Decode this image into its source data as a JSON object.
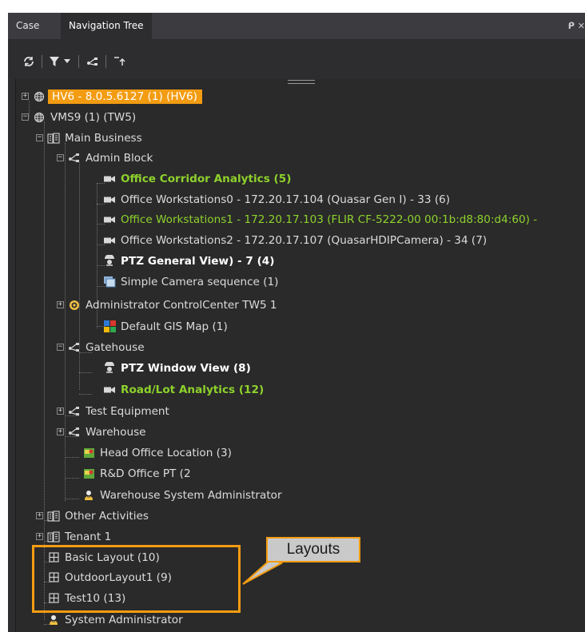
{
  "tabs": [
    {
      "label": "Case",
      "active": false
    },
    {
      "label": "Navigation Tree",
      "active": true
    }
  ],
  "tab_controls": "ᑭ ✕",
  "toolbar": {
    "buttons": [
      "refresh-icon",
      "filter-icon",
      "dropdown-icon",
      "tree-branch-icon",
      "collapse-up-icon"
    ]
  },
  "tree": [
    {
      "label": "HV6 - 8.0.5.6127 (1) (HV6)",
      "icon": "globe-icon",
      "expander": "+",
      "highlighted": true
    },
    {
      "label": "VMS9 (1) (TW5)",
      "icon": "globe-icon",
      "expander": "−"
    },
    {
      "label": "Main Business",
      "icon": "building-icon",
      "expander": "−"
    },
    {
      "label": "Admin Block",
      "icon": "branch-icon",
      "expander": "−"
    },
    {
      "label": "Office Corridor Analytics (5)",
      "icon": "camera-icon",
      "style": "bold-green"
    },
    {
      "label": "Office Workstations0 - 172.20.17.104 (Quasar Gen I) - 33 (6)",
      "icon": "camera-icon"
    },
    {
      "label": "Office Workstations1 - 172.20.17.103 (FLIR CF-5222-00 00:1b:d8:80:d4:60) -",
      "icon": "camera-icon",
      "style": "green"
    },
    {
      "label": "Office Workstations2 - 172.20.17.107 (QuasarHDIPCamera) - 34 (7)",
      "icon": "camera-icon"
    },
    {
      "label": "PTZ General View) - 7 (4)",
      "icon": "ptz-icon",
      "style": "bold"
    },
    {
      "label": "Simple Camera sequence (1)",
      "icon": "sequence-icon"
    },
    {
      "label": "Administrator ControlCenter TW5 1",
      "icon": "controlcenter-icon",
      "expander": "+"
    },
    {
      "label": "Default GIS Map (1)",
      "icon": "gis-map-icon"
    },
    {
      "label": "Gatehouse",
      "icon": "branch-icon",
      "expander": "−"
    },
    {
      "label": "PTZ Window View (8)",
      "icon": "ptz-icon",
      "style": "bold"
    },
    {
      "label": "Road/Lot Analytics (12)",
      "icon": "camera-icon",
      "style": "bold-green"
    },
    {
      "label": "Test Equipment",
      "icon": "branch-icon",
      "expander": "+"
    },
    {
      "label": "Warehouse",
      "icon": "branch-icon",
      "expander": "+"
    },
    {
      "label": "Head Office Location (3)",
      "icon": "location-map-icon"
    },
    {
      "label": "R&D Office PT (2",
      "icon": "location-map-icon"
    },
    {
      "label": "Warehouse System Administrator",
      "icon": "user-icon"
    },
    {
      "label": "Other Activities",
      "icon": "building-icon",
      "expander": "+"
    },
    {
      "label": "Tenant 1",
      "icon": "building-icon",
      "expander": "+"
    },
    {
      "label": "Basic Layout (10)",
      "icon": "layout-icon"
    },
    {
      "label": "OutdoorLayout1 (9)",
      "icon": "layout-icon"
    },
    {
      "label": "Test10 (13)",
      "icon": "layout-icon"
    },
    {
      "label": "System Administrator",
      "icon": "user-icon"
    }
  ],
  "callout": {
    "label": "Layouts"
  },
  "colors": {
    "highlight": "#f39c12",
    "green_text": "#8ed22c",
    "panel_bg": "#2d2d30"
  }
}
